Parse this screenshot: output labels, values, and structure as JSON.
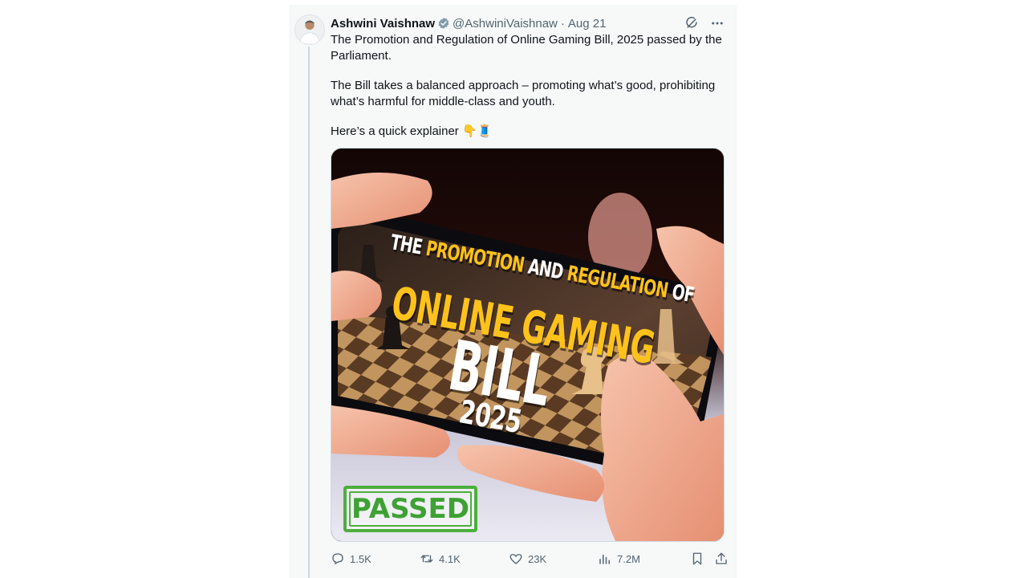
{
  "author": {
    "name": "Ashwini Vaishnaw",
    "handle": "@AshwiniVaishnaw",
    "separator": "·",
    "date": "Aug 21"
  },
  "body": {
    "paragraph_1": "The Promotion and Regulation of Online Gaming Bill, 2025 passed by the Parliament.",
    "paragraph_2": "The Bill takes a balanced approach – promoting what’s good, prohibiting what’s harmful for middle-class and youth.",
    "paragraph_3": "Here’s a quick explainer",
    "paragraph_3_emoji": "👇🧵"
  },
  "media": {
    "title_the": "THE",
    "title_promotion": "PROMOTION",
    "title_and": "AND",
    "title_regulation": "REGULATION",
    "title_of": "OF",
    "title_online_gaming": "ONLINE GAMING",
    "title_bill": "BILL",
    "title_year": "2025",
    "stamp": "PASSED"
  },
  "stats": {
    "replies": "1.5K",
    "reposts": "4.1K",
    "likes": "23K",
    "views": "7.2M"
  },
  "icons": {
    "verified": "verified-badge-icon",
    "grok": "grok-icon",
    "more": "more-icon",
    "reply": "reply-icon",
    "repost": "repost-icon",
    "like": "heart-icon",
    "views": "views-chart-icon",
    "bookmark": "bookmark-icon",
    "share": "share-icon"
  },
  "colors": {
    "background": "#f7f9f9",
    "text": "#0f1419",
    "muted": "#536471",
    "title_yellow": "#ffc21a",
    "stamp_green": "#4caf3d"
  }
}
